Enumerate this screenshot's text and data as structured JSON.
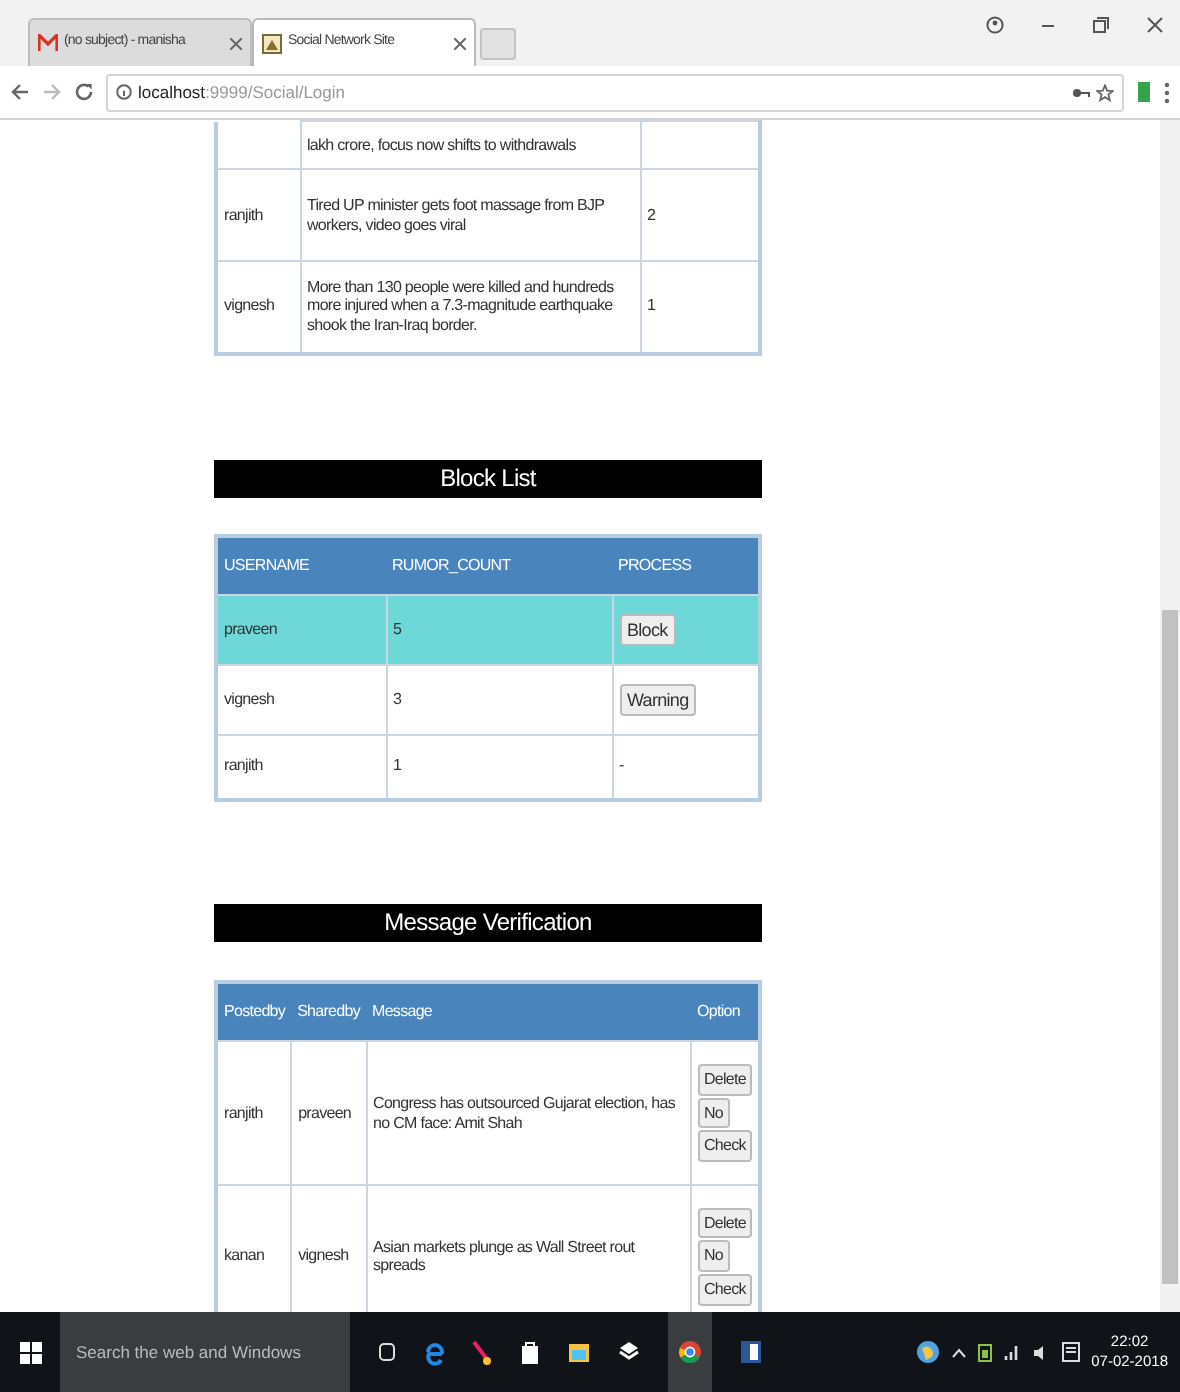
{
  "browser": {
    "tabs": [
      {
        "title": "(no subject) - manisha",
        "selected": false,
        "kind": "mail"
      },
      {
        "title": "Social Network Site",
        "selected": true,
        "kind": "page"
      }
    ],
    "url_host": "localhost",
    "url_path": ":9999/Social/Login"
  },
  "rumor_table": {
    "rows": [
      {
        "user": "",
        "message": "lakh crore, focus now shifts to withdrawals",
        "count": ""
      },
      {
        "user": "ranjith",
        "message": "Tired UP minister gets foot massage from BJP workers, video goes viral",
        "count": "2"
      },
      {
        "user": "vignesh",
        "message": "More than 130 people were killed and hundreds more injured when a 7.3-magnitude earthquake shook the Iran-Iraq border.",
        "count": "1"
      }
    ]
  },
  "block_list": {
    "title": "Block List",
    "columns": [
      "USERNAME",
      "RUMOR_COUNT",
      "PROCESS"
    ],
    "rows": [
      {
        "username": "praveen",
        "rumor_count": "5",
        "highlighted": true,
        "process": {
          "kind": "button",
          "label": "Block"
        }
      },
      {
        "username": "vignesh",
        "rumor_count": "3",
        "highlighted": false,
        "process": {
          "kind": "button",
          "label": "Warning"
        }
      },
      {
        "username": "ranjith",
        "rumor_count": "1",
        "highlighted": false,
        "process": {
          "kind": "text",
          "label": "-"
        }
      }
    ]
  },
  "message_verification": {
    "title": "Message Verification",
    "columns": [
      "Postedby",
      "Sharedby",
      "Message",
      "Option"
    ],
    "rows": [
      {
        "posted_by": "ranjith",
        "shared_by": "praveen",
        "message": "Congress has outsourced Gujarat election, has no CM face: Amit Shah",
        "options": [
          "Delete",
          "No",
          "Check"
        ]
      },
      {
        "posted_by": "kanan",
        "shared_by": "vignesh",
        "message": "Asian markets plunge as Wall Street rout spreads",
        "options": [
          "Delete",
          "No",
          "Check"
        ]
      }
    ]
  },
  "taskbar": {
    "search_placeholder": "Search the web and Windows",
    "time": "22:02",
    "date": "07-02-2018"
  }
}
